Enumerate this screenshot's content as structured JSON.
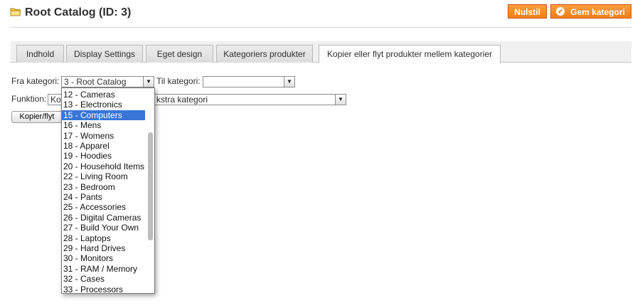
{
  "header": {
    "title": "Root Catalog (ID: 3)",
    "reset_label": "Nulstil",
    "save_label": "Gem kategori",
    "folder_icon": "folder-icon",
    "accent": "#f17f14"
  },
  "tabs": [
    {
      "label": "Indhold"
    },
    {
      "label": "Display Settings"
    },
    {
      "label": "Eget design"
    },
    {
      "label": "Kategoriers produkter"
    },
    {
      "label": "Kopier eller flyt produkter mellem kategorier",
      "active": true
    }
  ],
  "form": {
    "from_label": "Fra kategori:",
    "from_value": "3 - Root Catalog",
    "to_label": "Til kategori:",
    "to_value": "",
    "function_label": "Funktion:",
    "function_value_visible_start": "Ko",
    "function_value_visible_end": "kstra kategori",
    "submit_label": "Kopier/flyt"
  },
  "dropdown": {
    "selected": "15 - Computers",
    "options": [
      "12 - Cameras",
      "13 - Electronics",
      "15 - Computers",
      "16 - Mens",
      "17 - Womens",
      "18 - Apparel",
      "19 - Hoodies",
      "20 - Household Items",
      "22 - Living Room",
      "23 - Bedroom",
      "24 - Pants",
      "25 - Accessories",
      "26 - Digital Cameras",
      "27 - Build Your Own",
      "28 - Laptops",
      "29 - Hard Drives",
      "30 - Monitors",
      "31 - RAM / Memory",
      "32 - Cases",
      "33 - Processors"
    ]
  }
}
